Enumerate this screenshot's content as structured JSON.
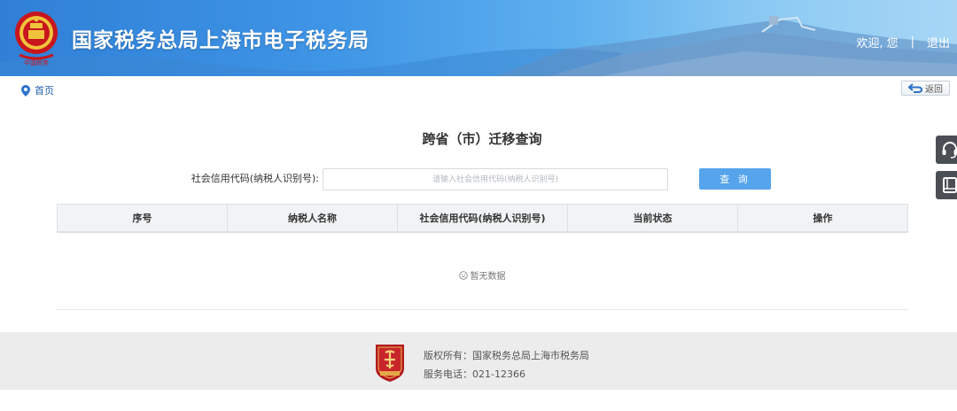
{
  "header": {
    "site_title": "国家税务总局上海市电子税务局",
    "welcome": "欢迎, 您",
    "separator": "|",
    "logout": "退出"
  },
  "breadcrumb": {
    "home": "首页"
  },
  "back_button": "返回",
  "page": {
    "title": "跨省（市）迁移查询"
  },
  "search": {
    "label": "社会信用代码(纳税人识别号):",
    "placeholder": "请输入社会信用代码(纳税人识别号)",
    "value": "",
    "button": "查 询"
  },
  "table": {
    "columns": [
      "序号",
      "纳税人名称",
      "社会信用代码(纳税人识别号)",
      "当前状态",
      "操作"
    ],
    "rows": [],
    "empty_text": "暂无数据"
  },
  "side_tools": [
    "headset-icon",
    "book-icon"
  ],
  "footer": {
    "copyright": "版权所有：国家税务总局上海市税务局",
    "phone": "服务电话：021-12366"
  },
  "colors": {
    "header_blue": "#3f95e6",
    "button_blue": "#55a4ec",
    "footer_bg": "#ececec",
    "emblem_red": "#c8161d"
  }
}
